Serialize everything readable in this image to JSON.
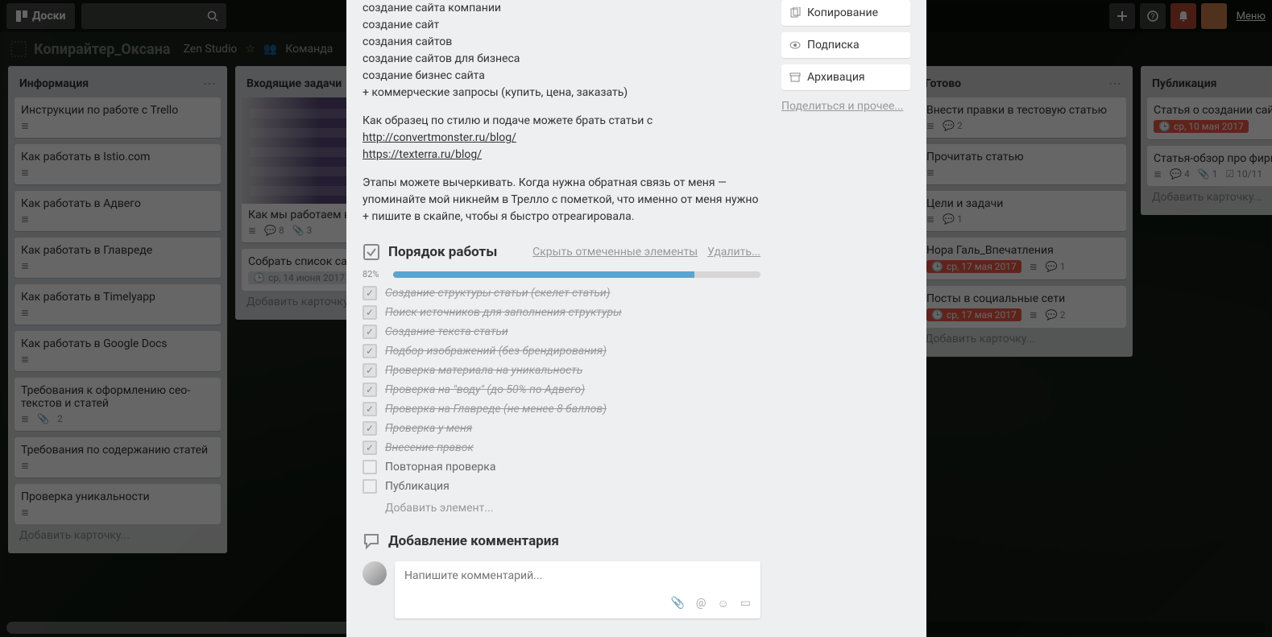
{
  "header": {
    "boards_btn": "Доски",
    "menu_link": "Меню"
  },
  "board_header": {
    "title": "Копирайтер_Оксана",
    "studio": "Zen Studio",
    "team": "Команда"
  },
  "lists": [
    {
      "title": "Информация",
      "cards": [
        {
          "title": "Инструкции по работе с Trello"
        },
        {
          "title": "Как работать в Istio.com"
        },
        {
          "title": "Как работать в Адвего"
        },
        {
          "title": "Как работать в Главреде"
        },
        {
          "title": "Как работать в Timelyapp"
        },
        {
          "title": "Как работать в Google Docs"
        },
        {
          "title": "Требования к оформлению сео-текстов и статей",
          "attach": 2
        },
        {
          "title": "Требования по содержанию статей"
        },
        {
          "title": "Проверка уникальности"
        }
      ],
      "add": "Добавить карточку..."
    },
    {
      "title": "Входящие задачи",
      "cards": [
        {
          "title": "Как мы работаем в",
          "cover": true,
          "comments": 8,
          "attach": 3
        },
        {
          "title": "Собрать список сайтов",
          "date": "ср, 14 июня 2017"
        }
      ],
      "add": "Добавить карточку..."
    },
    {
      "title": "Готово",
      "cards": [
        {
          "title": "Внести правки в тестовую статью",
          "comments": 2
        },
        {
          "title": "Прочитать статью"
        },
        {
          "title": "Цели и задачи",
          "comments": 1
        },
        {
          "title": "Нора Галь_Впечатления",
          "date": "ср, 17 мая 2017",
          "date_red": true,
          "comments": 1
        },
        {
          "title": "Посты в социальные сети",
          "date": "ср, 17 мая 2017",
          "date_red": true,
          "comments": 2
        }
      ],
      "add": "Добавить карточку..."
    },
    {
      "title": "Публикация",
      "cards": [
        {
          "title": "Статья о создании сайта",
          "date": "ср, 10 мая 2017",
          "date_red": true
        },
        {
          "title": "Статья-обзор про фирмы",
          "comments": 4,
          "attach": 1,
          "check": "10/11"
        }
      ],
      "add": "Добавить карточку..."
    }
  ],
  "modal": {
    "desc_lines": [
      "создание сайта компании",
      "создание сайт",
      "создания сайтов",
      "создание сайтов для бизнеса",
      "создание бизнес сайта",
      "+ коммерческие запросы (купить, цена, заказать)"
    ],
    "desc_p2": "Как образец по стилю и подаче можете брать статьи с",
    "link1": "http://convertmonster.ru/blog/",
    "link2": "https://texterra.ru/blog/",
    "desc_p3": "Этапы можете вычеркивать. Когда нужна обратная связь от меня — упоминайте мой никнейм в Трелло с пометкой, что именно от меня нужно + пишите в скайпе, чтобы я быстро отреагировала.",
    "checklist": {
      "title": "Порядок работы",
      "hide": "Скрыть отмеченные элементы",
      "delete": "Удалить...",
      "percent": "82%",
      "fill": 82,
      "items": [
        {
          "text": "Создание структуры статьи (скелет статьи)",
          "done": true
        },
        {
          "text": "Поиск источников для заполнения структуры",
          "done": true
        },
        {
          "text": "Создание текста статьи",
          "done": true
        },
        {
          "text": "Подбор изображений (без брендирования)",
          "done": true
        },
        {
          "text": "Проверка материала на уникальность",
          "done": true
        },
        {
          "text": "Проверка на \"воду\" (до 50% по Адвего)",
          "done": true
        },
        {
          "text": "Проверка на Главреде (не менее 8 баллов)",
          "done": true
        },
        {
          "text": "Проверка у меня",
          "done": true
        },
        {
          "text": "Внесение правок",
          "done": true
        },
        {
          "text": "Повторная проверка",
          "done": false
        },
        {
          "text": "Публикация",
          "done": false
        }
      ],
      "add": "Добавить элемент..."
    },
    "comments": {
      "title": "Добавление комментария",
      "placeholder": "Напишите комментарий..."
    },
    "sidebar": {
      "copy": "Копирование",
      "subscribe": "Подписка",
      "archive": "Архивация",
      "share": "Поделиться и прочее..."
    }
  }
}
